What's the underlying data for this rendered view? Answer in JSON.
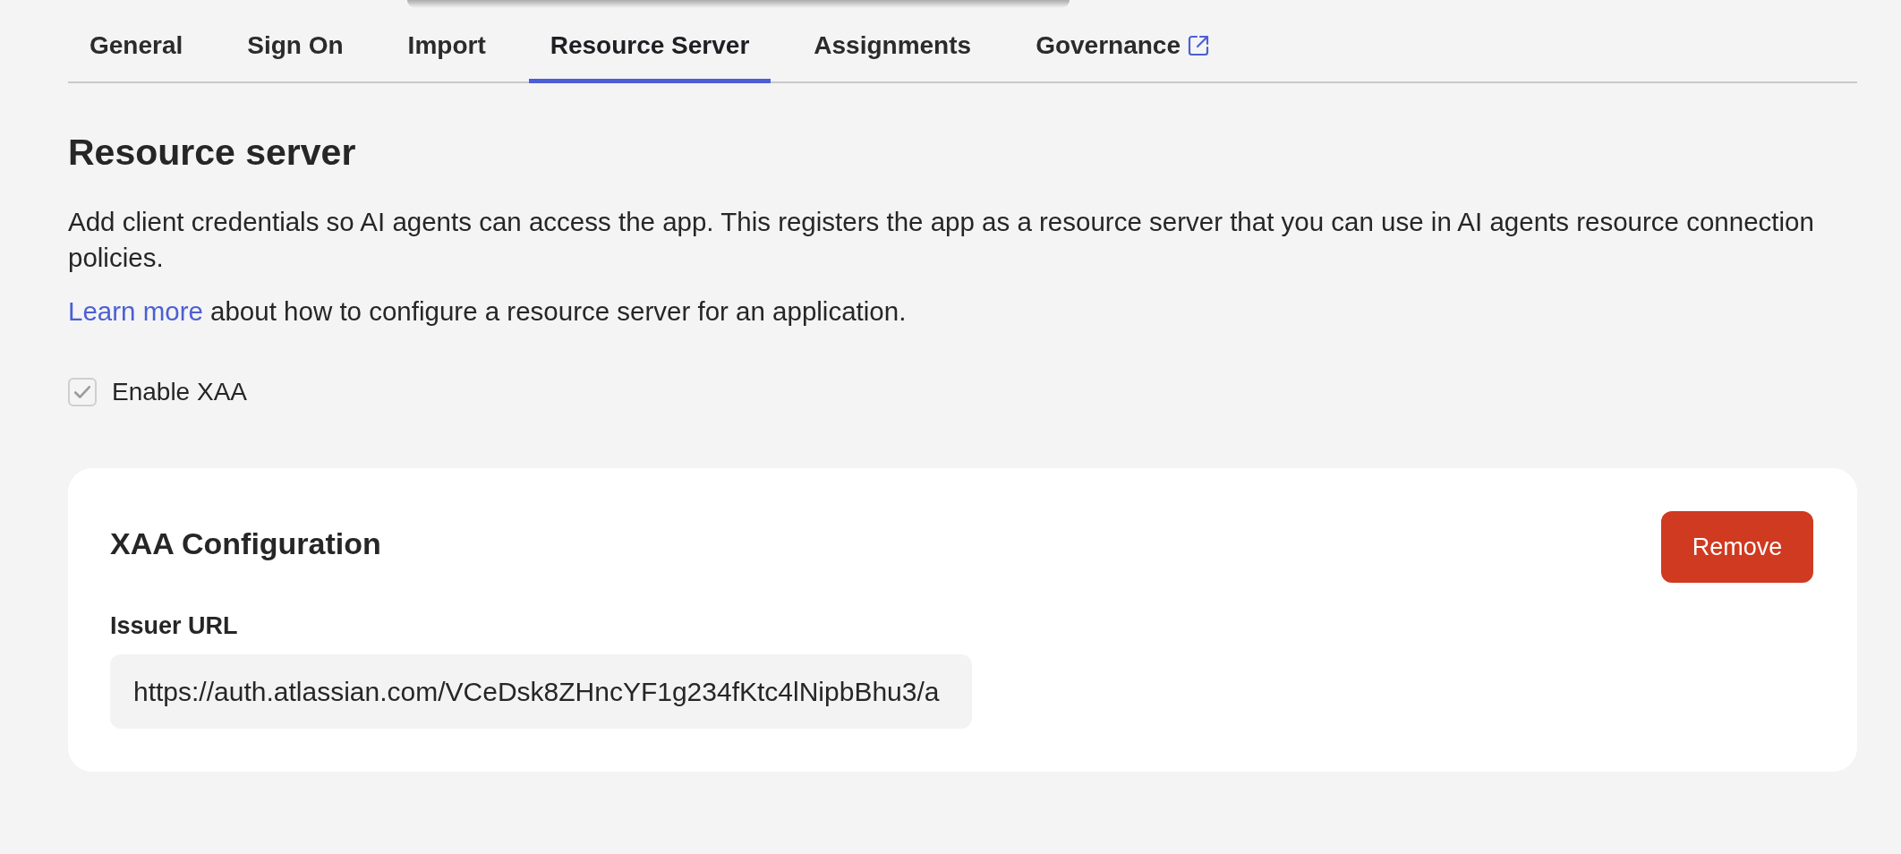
{
  "tabs": [
    {
      "label": "General",
      "selected": false,
      "external": false
    },
    {
      "label": "Sign On",
      "selected": false,
      "external": false
    },
    {
      "label": "Import",
      "selected": false,
      "external": false
    },
    {
      "label": "Resource Server",
      "selected": true,
      "external": false
    },
    {
      "label": "Assignments",
      "selected": false,
      "external": false
    },
    {
      "label": "Governance",
      "selected": false,
      "external": true
    }
  ],
  "section": {
    "title": "Resource server",
    "description": "Add client credentials so AI agents can access the app. This registers the app as a resource server that you can use in AI agents resource connection policies.",
    "learn_more": {
      "link": "Learn more",
      "text": "about how to configure a resource server for an application."
    }
  },
  "enable_checkbox": {
    "label": "Enable XAA",
    "checked": true,
    "disabled": true
  },
  "card": {
    "title": "XAA Configuration",
    "button": "Remove",
    "field": {
      "label": "Issuer URL",
      "value": "https://auth.atlassian.com/VCeDsk8ZHncYF1g234fKtc4lNipbBhu3/a"
    }
  }
}
